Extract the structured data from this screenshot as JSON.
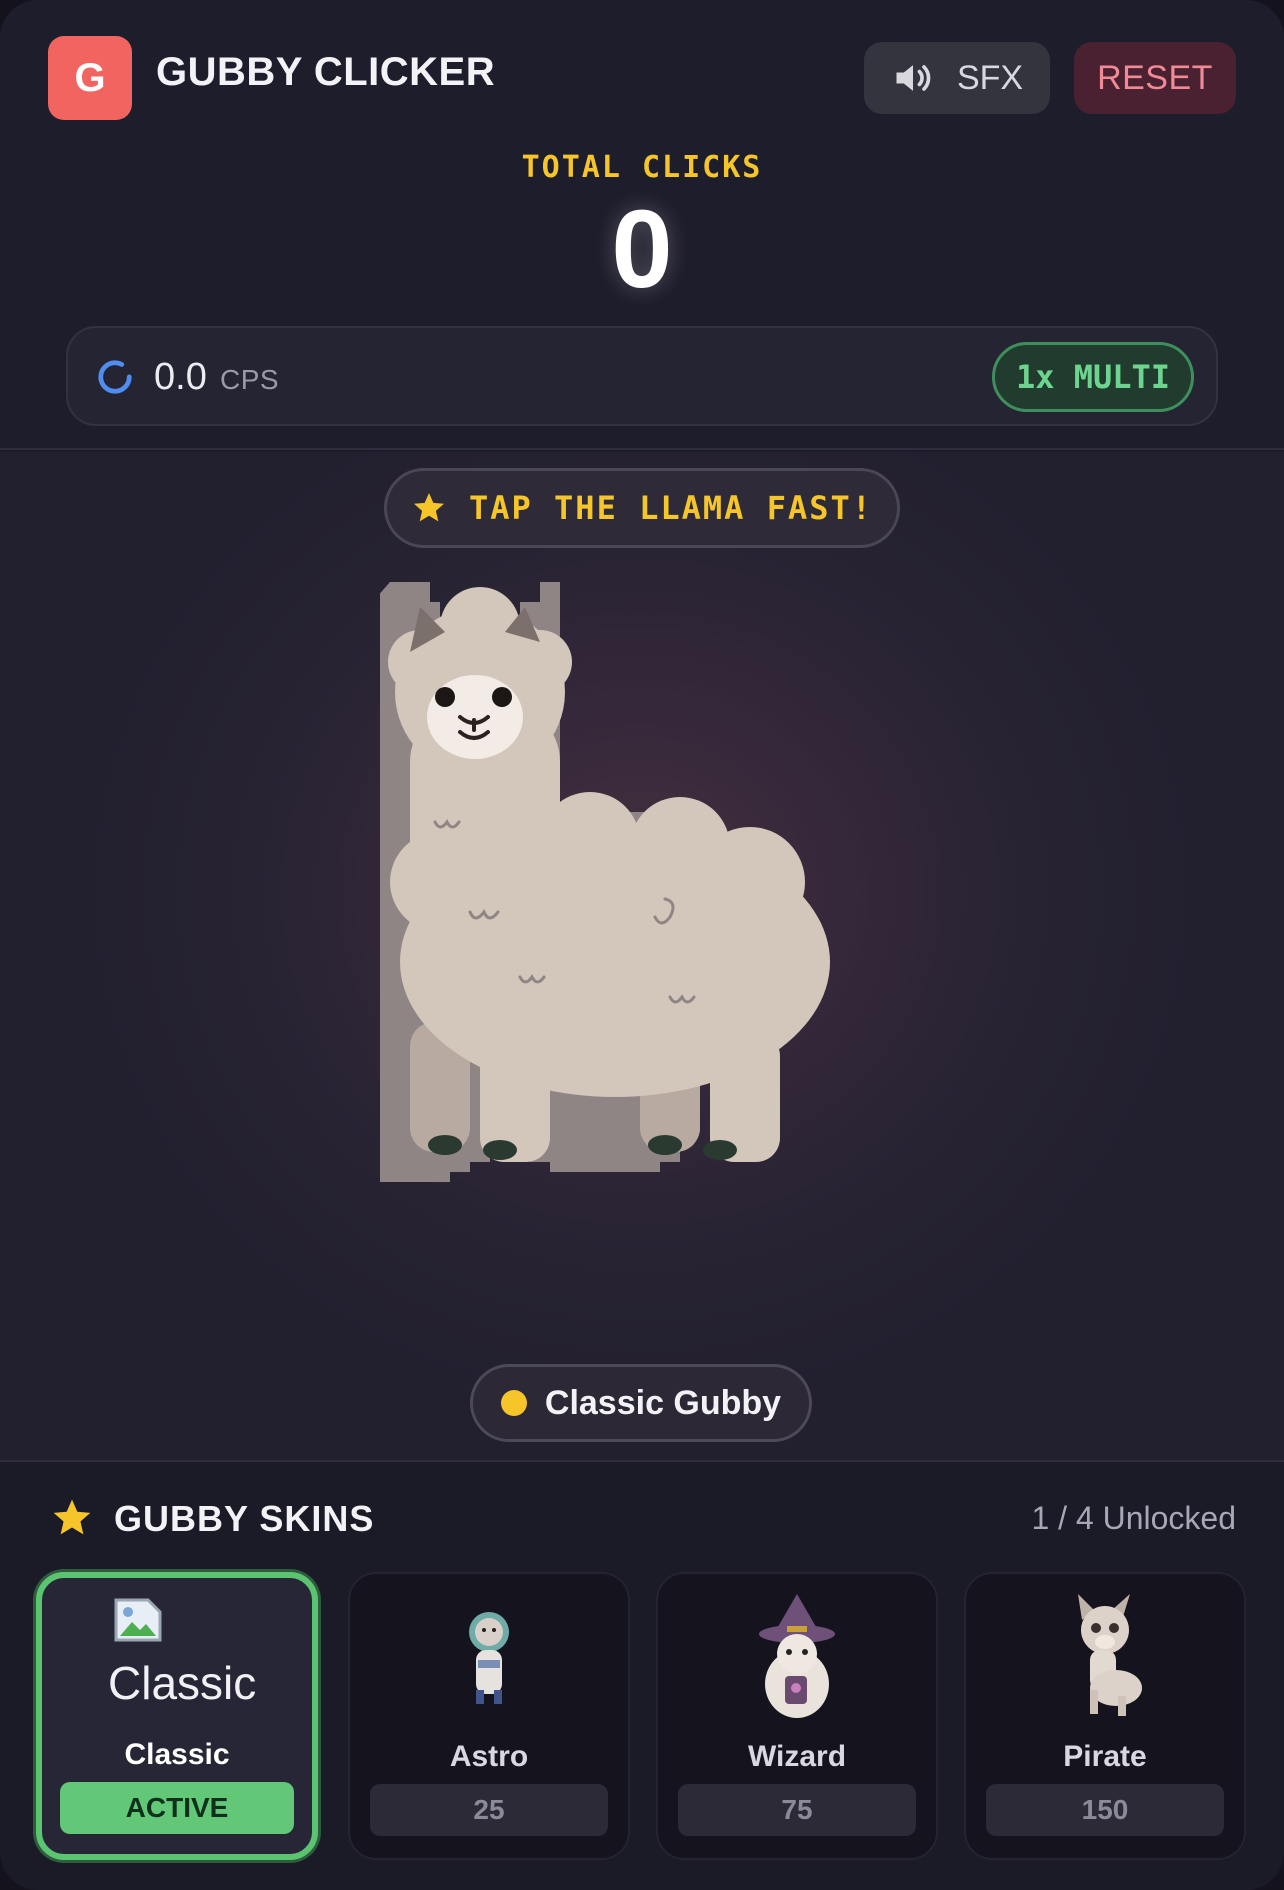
{
  "app": {
    "logo_letter": "G",
    "title": "GUBBY CLICKER"
  },
  "controls": {
    "sfx_label": "SFX",
    "reset_label": "RESET"
  },
  "score": {
    "label": "TOTAL CLICKS",
    "value": "0"
  },
  "stats": {
    "cps_value": "0.0",
    "cps_unit": "CPS",
    "multiplier": "1x MULTI"
  },
  "stage": {
    "hint": "TAP THE LLAMA FAST!",
    "current_skin": "Classic Gubby"
  },
  "skins": {
    "title": "GUBBY SKINS",
    "unlocked": "1 / 4 Unlocked",
    "items": [
      {
        "name": "Classic",
        "status": "ACTIVE",
        "image_alt": "Classic Gubby",
        "icon": "broken-image-icon"
      },
      {
        "name": "Astro",
        "price": "25",
        "icon": "astro-llama-icon"
      },
      {
        "name": "Wizard",
        "price": "75",
        "icon": "wizard-llama-icon"
      },
      {
        "name": "Pirate",
        "price": "150",
        "icon": "pirate-llama-icon"
      }
    ]
  },
  "colors": {
    "accent_yellow": "#f5c52a",
    "active_green": "#62c877",
    "reset_red": "#ef8a96",
    "logo_red": "#f2645f"
  }
}
